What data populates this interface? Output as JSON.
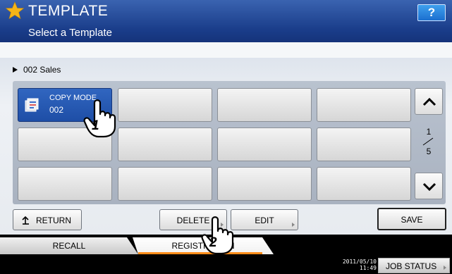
{
  "header": {
    "title": "TEMPLATE",
    "subtitle": "Select a Template",
    "help_label": "?"
  },
  "path": {
    "label": "002 Sales"
  },
  "templates": [
    {
      "line1": "COPY MODE",
      "line2": "002",
      "selected": true
    },
    {
      "line1": "",
      "line2": ""
    },
    {
      "line1": "",
      "line2": ""
    },
    {
      "line1": "",
      "line2": ""
    },
    {
      "line1": "",
      "line2": ""
    },
    {
      "line1": "",
      "line2": ""
    },
    {
      "line1": "",
      "line2": ""
    },
    {
      "line1": "",
      "line2": ""
    },
    {
      "line1": "",
      "line2": ""
    },
    {
      "line1": "",
      "line2": ""
    },
    {
      "line1": "",
      "line2": ""
    },
    {
      "line1": "",
      "line2": ""
    }
  ],
  "pager": {
    "current": "1",
    "total": "5"
  },
  "actions": {
    "return_label": "RETURN",
    "delete_label": "DELETE",
    "edit_label": "EDIT",
    "save_label": "SAVE"
  },
  "tabs": {
    "recall": "RECALL",
    "registration": "REGISTRATION"
  },
  "annotations": {
    "step1": "1",
    "step2": "2"
  },
  "status": {
    "date": "2011/05/10",
    "time": "11:49",
    "job_status_label": "JOB STATUS"
  },
  "colors": {
    "title_blue": "#1a3d8a",
    "selected_cell": "#1e4ea6",
    "tab_accent": "#ff8c1a",
    "help_blue": "#1b6fcf"
  }
}
